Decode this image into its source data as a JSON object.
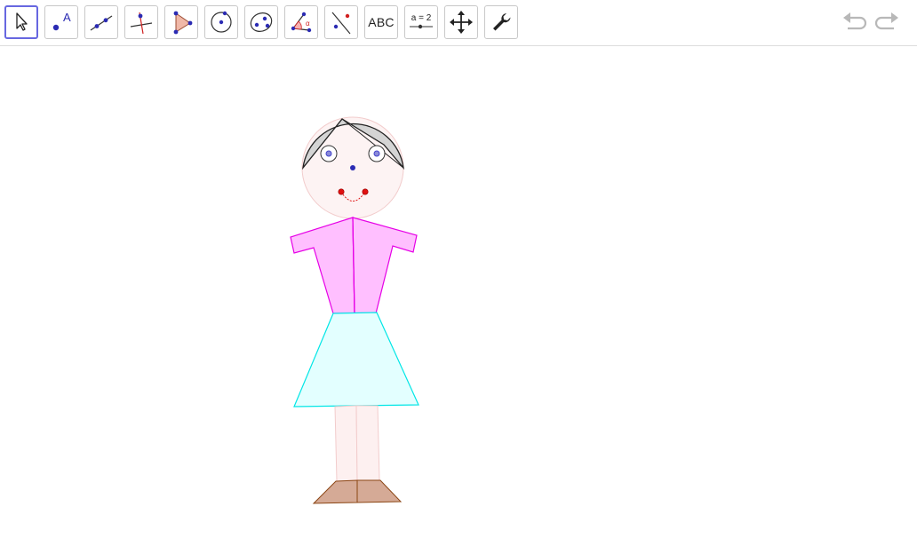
{
  "toolbar": {
    "tools": [
      {
        "name": "move-tool",
        "icon": "arrow-cursor-icon",
        "selected": true
      },
      {
        "name": "point-tool",
        "icon": "point-icon",
        "label": "A"
      },
      {
        "name": "line-tool",
        "icon": "line-icon"
      },
      {
        "name": "perpendicular-line-tool",
        "icon": "perpendicular-line-icon"
      },
      {
        "name": "polygon-tool",
        "icon": "polygon-icon"
      },
      {
        "name": "circle-tool",
        "icon": "circle-center-point-icon"
      },
      {
        "name": "ellipse-tool",
        "icon": "ellipse-icon"
      },
      {
        "name": "angle-tool",
        "icon": "angle-icon",
        "label": "α"
      },
      {
        "name": "reflect-tool",
        "icon": "reflect-line-icon"
      },
      {
        "name": "text-tool",
        "icon": "text-icon",
        "label": "ABC"
      },
      {
        "name": "slider-tool",
        "icon": "slider-icon",
        "label": "a = 2"
      },
      {
        "name": "move-graphics-view-tool",
        "icon": "move-arrows-icon"
      },
      {
        "name": "settings-tool",
        "icon": "wrench-icon"
      }
    ],
    "undo_icon": "undo-icon",
    "redo_icon": "redo-icon",
    "selected_color": "#6767e0"
  },
  "drawing": {
    "colors": {
      "hair": "#d4d4d4",
      "face": "#fdf3f3",
      "shirt": "#ffbfff",
      "shirt_stroke": "#e600e6",
      "skirt": "#e3ffff",
      "skirt_stroke": "#00e6e6",
      "legs": "#fdf0f0",
      "shoes": "#d5aa96",
      "shoes_stroke": "#8b4513",
      "eye_dot": "#4444cc",
      "mouth": "#e01010"
    }
  }
}
